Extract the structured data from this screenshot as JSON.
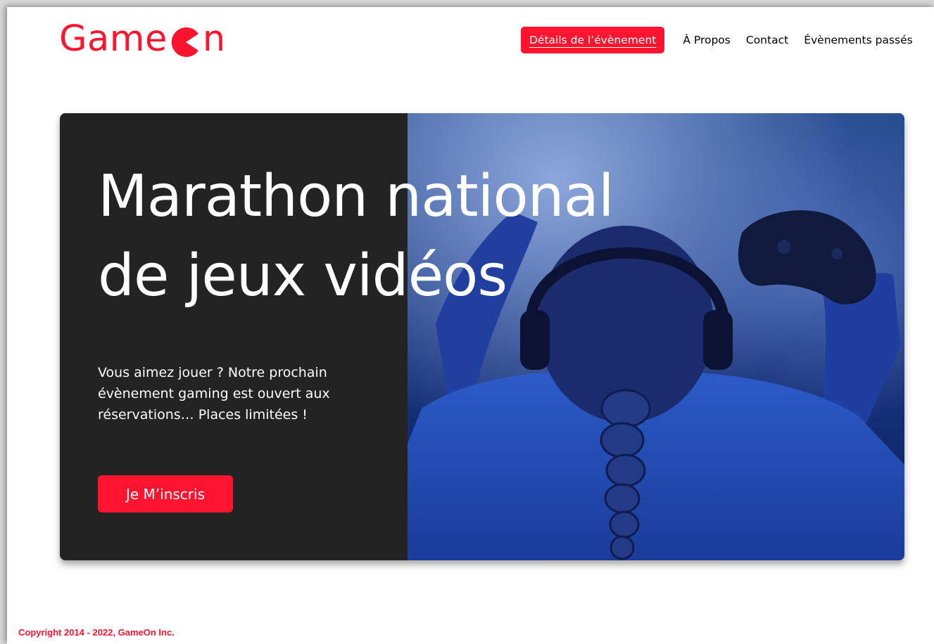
{
  "brand": {
    "name_before": "Game",
    "name_after": "n",
    "logo_icon": "pacman-icon",
    "color": "#fe142f"
  },
  "nav": {
    "items": [
      {
        "label": "Détails de l’évènement",
        "active": true
      },
      {
        "label": "À Propos"
      },
      {
        "label": "Contact"
      },
      {
        "label": "Évènements passés"
      }
    ]
  },
  "hero": {
    "title_line1": "Marathon national",
    "title_line2": "de jeux vidéos",
    "text": "Vous aimez jouer ? Notre prochain évènement gaming est ouvert aux réservations… Places limitées !",
    "cta_label": "Je M’inscris",
    "image": "gamer-photo"
  },
  "footer": {
    "copyright": "Copyright 2014 - 2022, GameOn Inc."
  },
  "colors": {
    "accent": "#fe142f",
    "hero_bg": "#232323"
  }
}
